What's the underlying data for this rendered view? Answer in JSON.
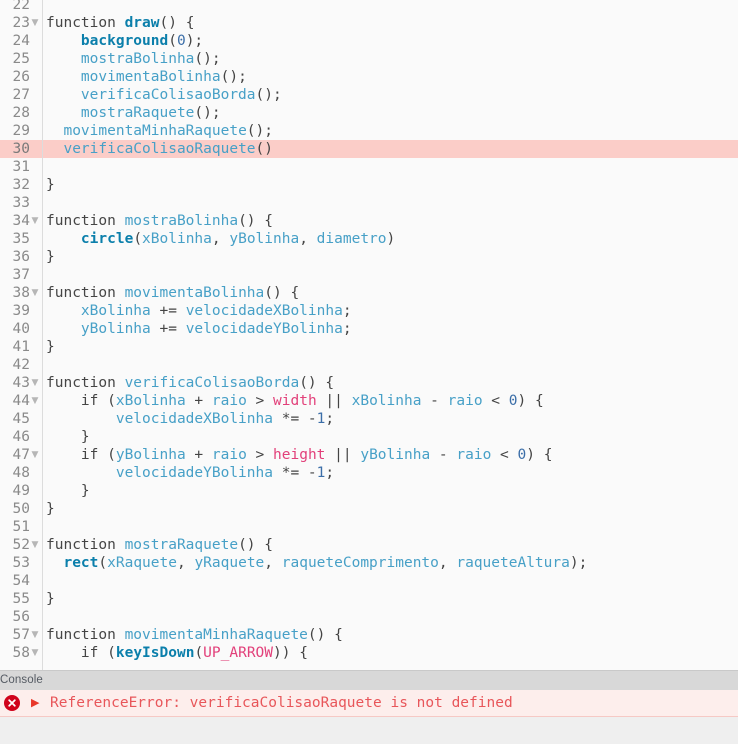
{
  "editor": {
    "name": "code-editor",
    "first_visible_line": 22,
    "active_line": 30,
    "lines": [
      {
        "n": 22,
        "fold": false,
        "active": false,
        "tokens": []
      },
      {
        "n": 23,
        "fold": true,
        "active": false,
        "tokens": [
          {
            "t": "kw",
            "s": "function "
          },
          {
            "t": "fn",
            "s": "draw"
          },
          {
            "t": "op",
            "s": "() {"
          }
        ]
      },
      {
        "n": 24,
        "fold": false,
        "active": false,
        "tokens": [
          {
            "t": "op",
            "s": "    "
          },
          {
            "t": "fn",
            "s": "background"
          },
          {
            "t": "op",
            "s": "("
          },
          {
            "t": "num",
            "s": "0"
          },
          {
            "t": "op",
            "s": ");"
          }
        ]
      },
      {
        "n": 25,
        "fold": false,
        "active": false,
        "tokens": [
          {
            "t": "op",
            "s": "    "
          },
          {
            "t": "def",
            "s": "mostraBolinha"
          },
          {
            "t": "op",
            "s": "();"
          }
        ]
      },
      {
        "n": 26,
        "fold": false,
        "active": false,
        "tokens": [
          {
            "t": "op",
            "s": "    "
          },
          {
            "t": "def",
            "s": "movimentaBolinha"
          },
          {
            "t": "op",
            "s": "();"
          }
        ]
      },
      {
        "n": 27,
        "fold": false,
        "active": false,
        "tokens": [
          {
            "t": "op",
            "s": "    "
          },
          {
            "t": "def",
            "s": "verificaColisaoBorda"
          },
          {
            "t": "op",
            "s": "();"
          }
        ]
      },
      {
        "n": 28,
        "fold": false,
        "active": false,
        "tokens": [
          {
            "t": "op",
            "s": "    "
          },
          {
            "t": "def",
            "s": "mostraRaquete"
          },
          {
            "t": "op",
            "s": "();"
          }
        ]
      },
      {
        "n": 29,
        "fold": false,
        "active": false,
        "tokens": [
          {
            "t": "op",
            "s": "  "
          },
          {
            "t": "def",
            "s": "movimentaMinhaRaquete"
          },
          {
            "t": "op",
            "s": "();"
          }
        ]
      },
      {
        "n": 30,
        "fold": false,
        "active": true,
        "tokens": [
          {
            "t": "op",
            "s": "  "
          },
          {
            "t": "def",
            "s": "verificaColisaoRaquete"
          },
          {
            "t": "op",
            "s": "()"
          }
        ]
      },
      {
        "n": 31,
        "fold": false,
        "active": false,
        "tokens": []
      },
      {
        "n": 32,
        "fold": false,
        "active": false,
        "tokens": [
          {
            "t": "op",
            "s": "}"
          }
        ]
      },
      {
        "n": 33,
        "fold": false,
        "active": false,
        "tokens": []
      },
      {
        "n": 34,
        "fold": true,
        "active": false,
        "tokens": [
          {
            "t": "kw",
            "s": "function "
          },
          {
            "t": "def",
            "s": "mostraBolinha"
          },
          {
            "t": "op",
            "s": "() {"
          }
        ]
      },
      {
        "n": 35,
        "fold": false,
        "active": false,
        "tokens": [
          {
            "t": "op",
            "s": "    "
          },
          {
            "t": "fn",
            "s": "circle"
          },
          {
            "t": "op",
            "s": "("
          },
          {
            "t": "id",
            "s": "xBolinha"
          },
          {
            "t": "op",
            "s": ", "
          },
          {
            "t": "id",
            "s": "yBolinha"
          },
          {
            "t": "op",
            "s": ", "
          },
          {
            "t": "id",
            "s": "diametro"
          },
          {
            "t": "op",
            "s": ")"
          }
        ]
      },
      {
        "n": 36,
        "fold": false,
        "active": false,
        "tokens": [
          {
            "t": "op",
            "s": "}"
          }
        ]
      },
      {
        "n": 37,
        "fold": false,
        "active": false,
        "tokens": []
      },
      {
        "n": 38,
        "fold": true,
        "active": false,
        "tokens": [
          {
            "t": "kw",
            "s": "function "
          },
          {
            "t": "def",
            "s": "movimentaBolinha"
          },
          {
            "t": "op",
            "s": "() {"
          }
        ]
      },
      {
        "n": 39,
        "fold": false,
        "active": false,
        "tokens": [
          {
            "t": "op",
            "s": "    "
          },
          {
            "t": "id",
            "s": "xBolinha"
          },
          {
            "t": "op",
            "s": " += "
          },
          {
            "t": "id",
            "s": "velocidadeXBolinha"
          },
          {
            "t": "op",
            "s": ";"
          }
        ]
      },
      {
        "n": 40,
        "fold": false,
        "active": false,
        "tokens": [
          {
            "t": "op",
            "s": "    "
          },
          {
            "t": "id",
            "s": "yBolinha"
          },
          {
            "t": "op",
            "s": " += "
          },
          {
            "t": "id",
            "s": "velocidadeYBolinha"
          },
          {
            "t": "op",
            "s": ";"
          }
        ]
      },
      {
        "n": 41,
        "fold": false,
        "active": false,
        "tokens": [
          {
            "t": "op",
            "s": "}"
          }
        ]
      },
      {
        "n": 42,
        "fold": false,
        "active": false,
        "tokens": []
      },
      {
        "n": 43,
        "fold": true,
        "active": false,
        "tokens": [
          {
            "t": "kw",
            "s": "function "
          },
          {
            "t": "def",
            "s": "verificaColisaoBorda"
          },
          {
            "t": "op",
            "s": "() {"
          }
        ]
      },
      {
        "n": 44,
        "fold": true,
        "active": false,
        "tokens": [
          {
            "t": "op",
            "s": "    "
          },
          {
            "t": "kw",
            "s": "if"
          },
          {
            "t": "op",
            "s": " ("
          },
          {
            "t": "id",
            "s": "xBolinha"
          },
          {
            "t": "op",
            "s": " + "
          },
          {
            "t": "id",
            "s": "raio"
          },
          {
            "t": "op",
            "s": " > "
          },
          {
            "t": "const",
            "s": "width"
          },
          {
            "t": "op",
            "s": " || "
          },
          {
            "t": "id",
            "s": "xBolinha"
          },
          {
            "t": "op",
            "s": " - "
          },
          {
            "t": "id",
            "s": "raio"
          },
          {
            "t": "op",
            "s": " < "
          },
          {
            "t": "num",
            "s": "0"
          },
          {
            "t": "op",
            "s": ") {"
          }
        ]
      },
      {
        "n": 45,
        "fold": false,
        "active": false,
        "tokens": [
          {
            "t": "op",
            "s": "        "
          },
          {
            "t": "id",
            "s": "velocidadeXBolinha"
          },
          {
            "t": "op",
            "s": " *= -"
          },
          {
            "t": "num",
            "s": "1"
          },
          {
            "t": "op",
            "s": ";"
          }
        ]
      },
      {
        "n": 46,
        "fold": false,
        "active": false,
        "tokens": [
          {
            "t": "op",
            "s": "    }"
          }
        ]
      },
      {
        "n": 47,
        "fold": true,
        "active": false,
        "tokens": [
          {
            "t": "op",
            "s": "    "
          },
          {
            "t": "kw",
            "s": "if"
          },
          {
            "t": "op",
            "s": " ("
          },
          {
            "t": "id",
            "s": "yBolinha"
          },
          {
            "t": "op",
            "s": " + "
          },
          {
            "t": "id",
            "s": "raio"
          },
          {
            "t": "op",
            "s": " > "
          },
          {
            "t": "const",
            "s": "height"
          },
          {
            "t": "op",
            "s": " || "
          },
          {
            "t": "id",
            "s": "yBolinha"
          },
          {
            "t": "op",
            "s": " - "
          },
          {
            "t": "id",
            "s": "raio"
          },
          {
            "t": "op",
            "s": " < "
          },
          {
            "t": "num",
            "s": "0"
          },
          {
            "t": "op",
            "s": ") {"
          }
        ]
      },
      {
        "n": 48,
        "fold": false,
        "active": false,
        "tokens": [
          {
            "t": "op",
            "s": "        "
          },
          {
            "t": "id",
            "s": "velocidadeYBolinha"
          },
          {
            "t": "op",
            "s": " *= -"
          },
          {
            "t": "num",
            "s": "1"
          },
          {
            "t": "op",
            "s": ";"
          }
        ]
      },
      {
        "n": 49,
        "fold": false,
        "active": false,
        "tokens": [
          {
            "t": "op",
            "s": "    }"
          }
        ]
      },
      {
        "n": 50,
        "fold": false,
        "active": false,
        "tokens": [
          {
            "t": "op",
            "s": "}"
          }
        ]
      },
      {
        "n": 51,
        "fold": false,
        "active": false,
        "tokens": []
      },
      {
        "n": 52,
        "fold": true,
        "active": false,
        "tokens": [
          {
            "t": "kw",
            "s": "function "
          },
          {
            "t": "def",
            "s": "mostraRaquete"
          },
          {
            "t": "op",
            "s": "() {"
          }
        ]
      },
      {
        "n": 53,
        "fold": false,
        "active": false,
        "tokens": [
          {
            "t": "op",
            "s": "  "
          },
          {
            "t": "fn",
            "s": "rect"
          },
          {
            "t": "op",
            "s": "("
          },
          {
            "t": "id",
            "s": "xRaquete"
          },
          {
            "t": "op",
            "s": ", "
          },
          {
            "t": "id",
            "s": "yRaquete"
          },
          {
            "t": "op",
            "s": ", "
          },
          {
            "t": "id",
            "s": "raqueteComprimento"
          },
          {
            "t": "op",
            "s": ", "
          },
          {
            "t": "id",
            "s": "raqueteAltura"
          },
          {
            "t": "op",
            "s": ");"
          }
        ]
      },
      {
        "n": 54,
        "fold": false,
        "active": false,
        "tokens": []
      },
      {
        "n": 55,
        "fold": false,
        "active": false,
        "tokens": [
          {
            "t": "op",
            "s": "}"
          }
        ]
      },
      {
        "n": 56,
        "fold": false,
        "active": false,
        "tokens": []
      },
      {
        "n": 57,
        "fold": true,
        "active": false,
        "tokens": [
          {
            "t": "kw",
            "s": "function "
          },
          {
            "t": "def",
            "s": "movimentaMinhaRaquete"
          },
          {
            "t": "op",
            "s": "() {"
          }
        ]
      },
      {
        "n": 58,
        "fold": true,
        "active": false,
        "tokens": [
          {
            "t": "op",
            "s": "    "
          },
          {
            "t": "kw",
            "s": "if"
          },
          {
            "t": "op",
            "s": " ("
          },
          {
            "t": "fn",
            "s": "keyIsDown"
          },
          {
            "t": "op",
            "s": "("
          },
          {
            "t": "const",
            "s": "UP_ARROW"
          },
          {
            "t": "op",
            "s": ")) {"
          }
        ]
      }
    ]
  },
  "console": {
    "title": "Console",
    "messages": [
      {
        "level": "error",
        "icon": "error-circle-icon",
        "expand_icon": "play-triangle-icon",
        "text": "ReferenceError: verificaColisaoRaquete is not defined"
      }
    ]
  },
  "colors": {
    "editor_bg": "#fafafa",
    "active_line": "#fbcdc8",
    "gutter_text": "#8a8a8a",
    "keyword": "#454545",
    "builtin_fn": "#0b7fab",
    "identifier": "#47a0c7",
    "constant": "#e2407a",
    "number": "#3b6ea8",
    "console_header_bg": "#d8d8d8",
    "console_error_bg": "#fdeeec",
    "console_error_text": "#e8565a",
    "console_body_bg": "#efefef"
  }
}
